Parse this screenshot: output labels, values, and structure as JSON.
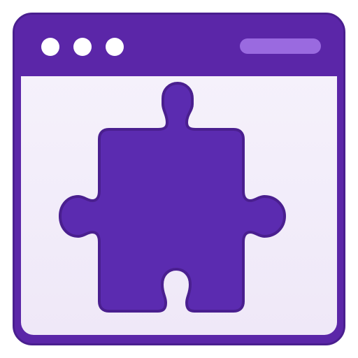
{
  "window": {
    "titlebar_dots": [
      "window-dot",
      "window-dot",
      "window-dot"
    ],
    "address_bar_text": ""
  },
  "content": {
    "icon": "puzzle-piece-icon"
  },
  "colors": {
    "frame": "#5b26a8",
    "frame_border": "#4a1f8f",
    "content_bg": "#f5f1fb",
    "pill": "#9a6ae0",
    "dot": "#ffffff",
    "puzzle_fill": "#5b2bb0",
    "puzzle_stroke": "#4a1f8f"
  }
}
